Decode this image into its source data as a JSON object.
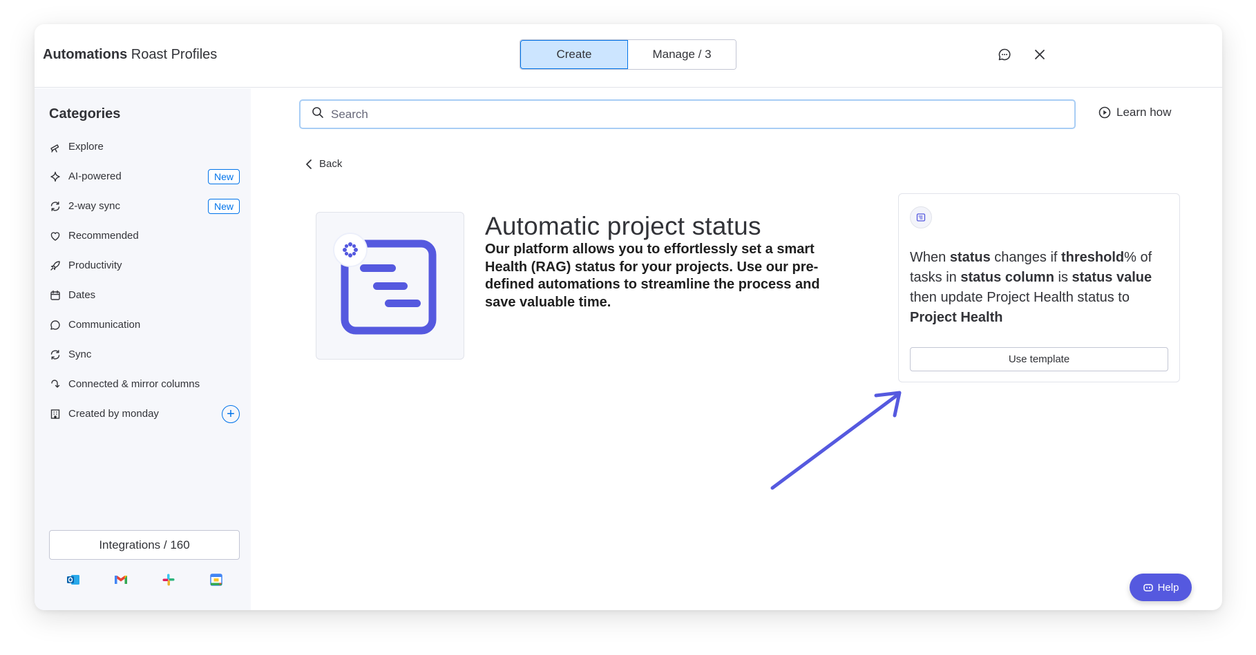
{
  "header": {
    "title_bold": "Automations",
    "title_rest": " Roast Profiles",
    "tabs": [
      {
        "label": "Create",
        "active": true
      },
      {
        "label": "Manage / 3",
        "active": false
      }
    ],
    "feedback_icon": "chat-feedback-icon",
    "close_icon": "close-icon"
  },
  "sidebar": {
    "title": "Categories",
    "items": [
      {
        "label": "Explore",
        "icon": "telescope-icon"
      },
      {
        "label": "AI-powered",
        "icon": "sparkle-icon",
        "badge": "New"
      },
      {
        "label": "2-way sync",
        "icon": "sync-icon",
        "badge": "New"
      },
      {
        "label": "Recommended",
        "icon": "heart-icon"
      },
      {
        "label": "Productivity",
        "icon": "rocket-icon"
      },
      {
        "label": "Dates",
        "icon": "calendar-icon"
      },
      {
        "label": "Communication",
        "icon": "speech-bubble-icon"
      },
      {
        "label": "Sync",
        "icon": "sync-icon"
      },
      {
        "label": "Connected & mirror columns",
        "icon": "link-arrow-icon"
      },
      {
        "label": "Created by monday",
        "icon": "building-icon",
        "action": "+"
      }
    ],
    "integrations_label": "Integrations / 160",
    "apps": [
      "outlook-icon",
      "gmail-icon",
      "slack-icon",
      "google-calendar-icon"
    ]
  },
  "main": {
    "search_placeholder": "Search",
    "learn_how": "Learn how",
    "back": "Back",
    "page_heading": "Automatic project status",
    "description": "Our platform allows you to effortlessly set a smart Health (RAG) status for your projects. Use our pre-defined automations to streamline the process and save valuable time.",
    "recipe": {
      "t1": "When ",
      "b1": "status",
      "t2": " changes if ",
      "b2": "threshold",
      "t3": "% of tasks in ",
      "b3": "status column",
      "t4": " is ",
      "b4": "status value",
      "t5": " then update Project Health status to ",
      "b5": "Project Health"
    },
    "use_template": "Use template",
    "help": "Help"
  },
  "colors": {
    "accent": "#0073ea",
    "active_tab_bg": "#cce5ff",
    "brand_purple": "#5559df",
    "sidebar_bg": "#f6f7fb"
  }
}
